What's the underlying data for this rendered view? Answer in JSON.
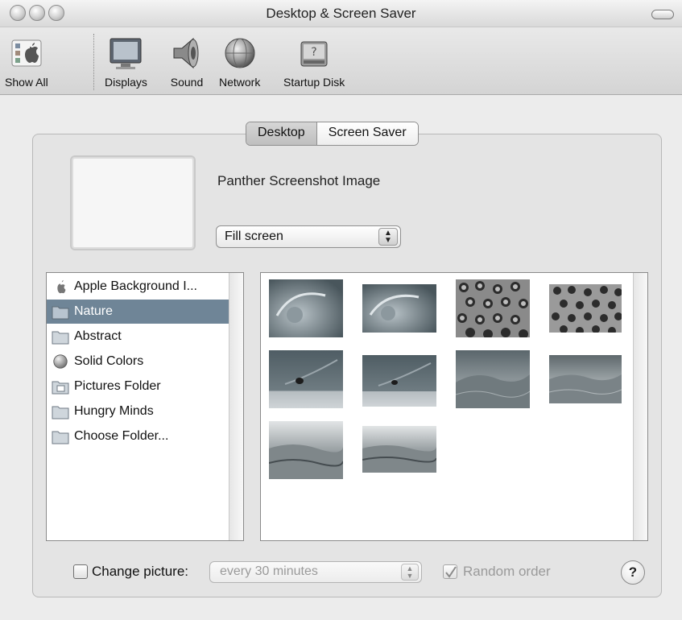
{
  "window": {
    "title": "Desktop & Screen Saver"
  },
  "toolbar": {
    "items": [
      {
        "label": "Show All",
        "icon": "show-all-icon"
      },
      {
        "label": "Displays",
        "icon": "displays-icon"
      },
      {
        "label": "Sound",
        "icon": "sound-icon"
      },
      {
        "label": "Network",
        "icon": "network-icon"
      },
      {
        "label": "Startup Disk",
        "icon": "startup-disk-icon"
      }
    ]
  },
  "tabs": [
    {
      "label": "Desktop",
      "selected": true
    },
    {
      "label": "Screen Saver",
      "selected": false
    }
  ],
  "preview": {
    "image_name": "Panther Screenshot Image",
    "fit_option": "Fill screen"
  },
  "source_list": {
    "items": [
      {
        "label": "Apple Background I...",
        "icon": "apple-icon",
        "selected": false
      },
      {
        "label": "Nature",
        "icon": "folder-icon",
        "selected": true
      },
      {
        "label": "Abstract",
        "icon": "folder-icon",
        "selected": false
      },
      {
        "label": "Solid Colors",
        "icon": "sphere-icon",
        "selected": false
      },
      {
        "label": "Pictures Folder",
        "icon": "pictures-folder-icon",
        "selected": false
      },
      {
        "label": "Hungry Minds",
        "icon": "folder-icon",
        "selected": false
      },
      {
        "label": "Choose Folder...",
        "icon": "folder-icon",
        "selected": false
      }
    ]
  },
  "thumbnails": [
    {
      "name": "water-droplet-1"
    },
    {
      "name": "water-droplet-2"
    },
    {
      "name": "leopard-spots-1"
    },
    {
      "name": "leopard-spots-2"
    },
    {
      "name": "ladybug-leaf-1"
    },
    {
      "name": "ladybug-leaf-2"
    },
    {
      "name": "sand-dunes-1"
    },
    {
      "name": "sand-dunes-2"
    },
    {
      "name": "desert-dunes-1"
    },
    {
      "name": "desert-dunes-2"
    }
  ],
  "bottom": {
    "change_picture_label": "Change picture:",
    "change_picture_checked": false,
    "interval": "every 30 minutes",
    "random_order_label": "Random order",
    "random_order_checked": true,
    "help_label": "?"
  }
}
